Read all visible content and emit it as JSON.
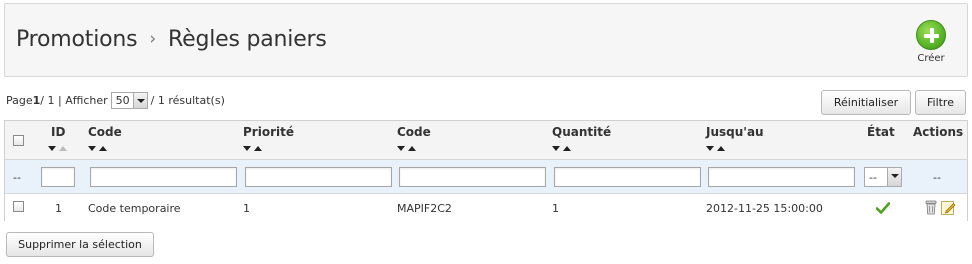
{
  "header": {
    "section": "Promotions",
    "separator": "›",
    "page": "Règles paniers",
    "create_label": "Créer"
  },
  "pager": {
    "prefix": "Page ",
    "current": "1",
    "sep": " / 1 | Afficher ",
    "per_page": "50",
    "results": "/ 1 résultat(s)"
  },
  "buttons": {
    "reset": "Réinitialiser",
    "filter": "Filtre",
    "delete_selection": "Supprimer la sélection"
  },
  "table": {
    "columns": {
      "id": "ID",
      "name": "Code",
      "priority": "Priorité",
      "code": "Code",
      "quantity": "Quantité",
      "until": "Jusqu'au",
      "status": "État",
      "actions": "Actions"
    },
    "filters": {
      "dash_left": "--",
      "status_select": "--",
      "dash_actions": "--"
    },
    "rows": [
      {
        "id": "1",
        "name": "Code temporaire",
        "priority": "1",
        "code": "MAPIF2C2",
        "quantity": "1",
        "until": "2012-11-25 15:00:00",
        "status_icon": "check-icon",
        "actions": [
          "trash-icon",
          "edit-icon"
        ]
      }
    ]
  },
  "colors": {
    "accent_green": "#5cb82a",
    "filter_row_bg": "#e9f2fa",
    "header_bg": "#f4f4f4"
  }
}
